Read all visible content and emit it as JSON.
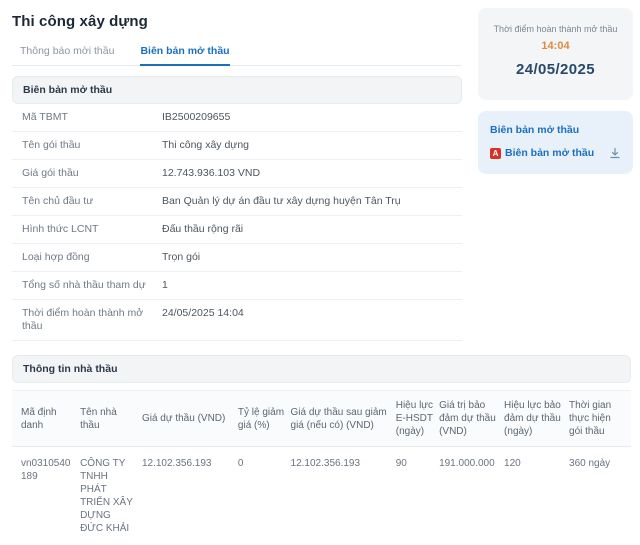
{
  "page": {
    "title": "Thi công xây dựng"
  },
  "tabs": [
    {
      "label": "Thông báo mời thầu",
      "active": false
    },
    {
      "label": "Biên bản mở thầu",
      "active": true
    }
  ],
  "bid_record": {
    "section_title": "Biên bản mở thầu",
    "rows": [
      {
        "label": "Mã TBMT",
        "value": "IB2500209655"
      },
      {
        "label": "Tên gói thầu",
        "value": "Thi công xây dựng"
      },
      {
        "label": "Giá gói thầu",
        "value": "12.743.936.103 VND"
      },
      {
        "label": "Tên chủ đầu tư",
        "value": "Ban Quản lý dự án đầu tư xây dựng huyện Tân Trụ"
      },
      {
        "label": "Hình thức LCNT",
        "value": "Đấu thầu rộng rãi"
      },
      {
        "label": "Loại hợp đồng",
        "value": "Trọn gói"
      },
      {
        "label": "Tổng số nhà thầu tham dự",
        "value": "1"
      },
      {
        "label": "Thời điểm hoàn thành mở thầu",
        "value": "24/05/2025 14:04"
      }
    ]
  },
  "completion_card": {
    "label": "Thời điểm hoàn thành mở thầu",
    "time": "14:04",
    "date": "24/05/2025"
  },
  "document_card": {
    "title": "Biên bản mở thầu",
    "file_label": "Biên bản mở thầu",
    "pdf_icon_glyph": "A",
    "icons": {
      "pdf": "pdf-file-icon",
      "download": "download-icon"
    }
  },
  "contractors": {
    "section_title": "Thông tin nhà thầu",
    "columns": [
      "Mã định danh",
      "Tên nhà thầu",
      "Giá dự thầu (VND)",
      "Tỷ lệ giảm giá (%)",
      "Giá dự thầu sau giảm giá (nếu có) (VND)",
      "Hiệu lực E-HSDT (ngày)",
      "Giá trị bảo đảm dự thầu (VND)",
      "Hiệu lực bảo đảm dự thầu (ngày)",
      "Thời gian thực hiện gói thầu"
    ],
    "rows": [
      [
        "vn0310540189",
        "CÔNG TY TNHH PHÁT TRIỂN XÂY DỰNG ĐỨC KHẢI",
        "12.102.356.193",
        "0",
        "12.102.356.193",
        "90",
        "191.000.000",
        "120",
        "360 ngày"
      ]
    ]
  },
  "colors": {
    "accent_blue": "#1a6fc0",
    "time_orange": "#dd8a42",
    "date_navy": "#27496b",
    "pdf_red": "#d93025",
    "section_bar_bg": "#f3f4f6",
    "doc_card_bg": "#e8f1fa"
  }
}
